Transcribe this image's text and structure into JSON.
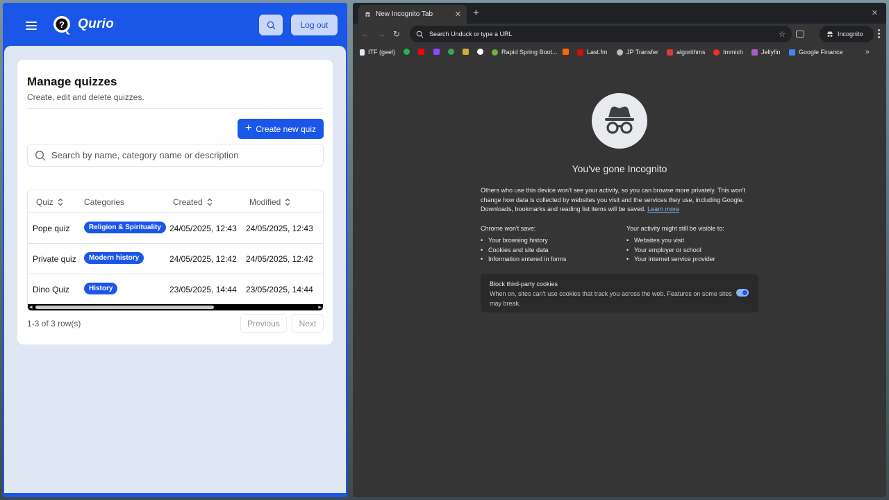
{
  "app": {
    "name": "Qurio",
    "logout_label": "Log out",
    "page_title": "Manage quizzes",
    "page_subtitle": "Create, edit and delete quizzes.",
    "create_label": "Create new quiz",
    "search_placeholder": "Search by name, category name or description",
    "columns": {
      "quiz": "Quiz",
      "categories": "Categories",
      "created": "Created",
      "modified": "Modified"
    },
    "rows": [
      {
        "quiz": "Pope quiz",
        "category": "Religion & Spirituality",
        "created": "24/05/2025, 12:43",
        "modified": "24/05/2025, 12:43"
      },
      {
        "quiz": "Private quiz",
        "category": "Modern history",
        "created": "24/05/2025, 12:42",
        "modified": "24/05/2025, 12:42"
      },
      {
        "quiz": "Dino Quiz",
        "category": "History",
        "created": "23/05/2025, 14:44",
        "modified": "23/05/2025, 14:44"
      }
    ],
    "row_count": "1-3 of 3 row(s)",
    "previous_label": "Previous",
    "next_label": "Next",
    "colors": {
      "primary": "#1a56e8",
      "surface": "#dfe6f4"
    }
  },
  "browser": {
    "tab_title": "New Incognito Tab",
    "omnibox_placeholder": "Search Unduck or type a URL",
    "incognito_label": "Incognito",
    "bookmarks": [
      {
        "label": "ITF (geel)",
        "color": "#e8eaed"
      },
      {
        "label": "",
        "color": "#1db954"
      },
      {
        "label": "",
        "color": "#ff0000"
      },
      {
        "label": "",
        "color": "#9146ff"
      },
      {
        "label": "",
        "color": "#34a853"
      },
      {
        "label": "",
        "color": "#c9b037"
      },
      {
        "label": "",
        "color": "#ffffff"
      },
      {
        "label": "Rapid Spring Boot...",
        "color": "#6db33f"
      },
      {
        "label": "",
        "color": "#ff6600"
      },
      {
        "label": "Last.fm",
        "color": "#d51007"
      },
      {
        "label": "JP Transfer",
        "color": "#bbbbbb"
      },
      {
        "label": "algorithms",
        "color": "#e53935"
      },
      {
        "label": "Immich",
        "color": "#fa2921"
      },
      {
        "label": "Jellyfin",
        "color": "#aa5cc3"
      },
      {
        "label": "Google Finance",
        "color": "#4285f4"
      }
    ],
    "ntp": {
      "title": "You've gone Incognito",
      "paragraph": "Others who use this device won't see your activity, so you can browse more privately. This won't change how data is collected by websites you visit and the services they use, including Google. Downloads, bookmarks and reading list items will be saved.",
      "learn_more": "Learn more",
      "wont_save_heading": "Chrome won't save:",
      "wont_save": [
        "Your browsing history",
        "Cookies and site data",
        "Information entered in forms"
      ],
      "visible_heading": "Your activity might still be visible to:",
      "visible": [
        "Websites you visit",
        "Your employer or school",
        "Your internet service provider"
      ],
      "cookie_title": "Block third-party cookies",
      "cookie_text": "When on, sites can't use cookies that track you across the web. Features on some sites may break."
    }
  }
}
